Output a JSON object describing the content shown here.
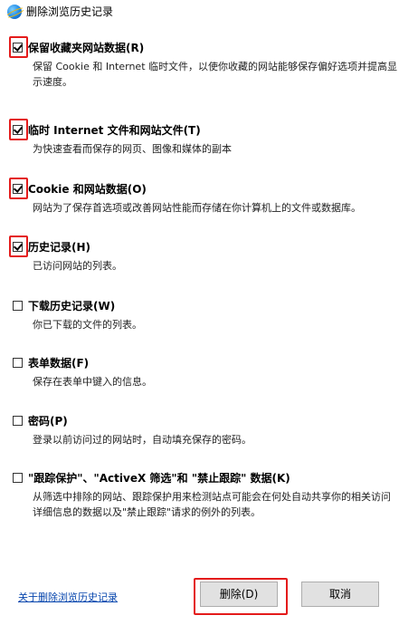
{
  "window": {
    "title": "删除浏览历史记录",
    "icon": "internet-explorer-icon"
  },
  "options": [
    {
      "id": "preserve-favorites",
      "label": "保留收藏夹网站数据(R)",
      "checked": true,
      "description": "保留 Cookie 和 Internet 临时文件，以使你收藏的网站能够保存偏好选项并提高显示速度。"
    },
    {
      "id": "temp-internet-files",
      "label": "临时 Internet 文件和网站文件(T)",
      "checked": true,
      "description": "为快速查看而保存的网页、图像和媒体的副本"
    },
    {
      "id": "cookies",
      "label": "Cookie 和网站数据(O)",
      "checked": true,
      "description": "网站为了保存首选项或改善网站性能而存储在你计算机上的文件或数据库。"
    },
    {
      "id": "history",
      "label": "历史记录(H)",
      "checked": true,
      "description": "已访问网站的列表。"
    },
    {
      "id": "download-history",
      "label": "下载历史记录(W)",
      "checked": false,
      "description": "你已下载的文件的列表。"
    },
    {
      "id": "form-data",
      "label": "表单数据(F)",
      "checked": false,
      "description": "保存在表单中键入的信息。"
    },
    {
      "id": "passwords",
      "label": "密码(P)",
      "checked": false,
      "description": "登录以前访问过的网站时，自动填充保存的密码。"
    },
    {
      "id": "tracking-protection",
      "label": "\"跟踪保护\"、\"ActiveX 筛选\"和 \"禁止跟踪\" 数据(K)",
      "checked": false,
      "description": "从筛选中排除的网站、跟踪保护用来检测站点可能会在何处自动共享你的相关访问详细信息的数据以及\"禁止跟踪\"请求的例外的列表。"
    }
  ],
  "footer": {
    "about_link": "关于删除浏览历史记录",
    "delete_button": "删除(D)",
    "cancel_button": "取消"
  },
  "colors": {
    "highlight": "#e41b1b",
    "link": "#0645ad"
  }
}
